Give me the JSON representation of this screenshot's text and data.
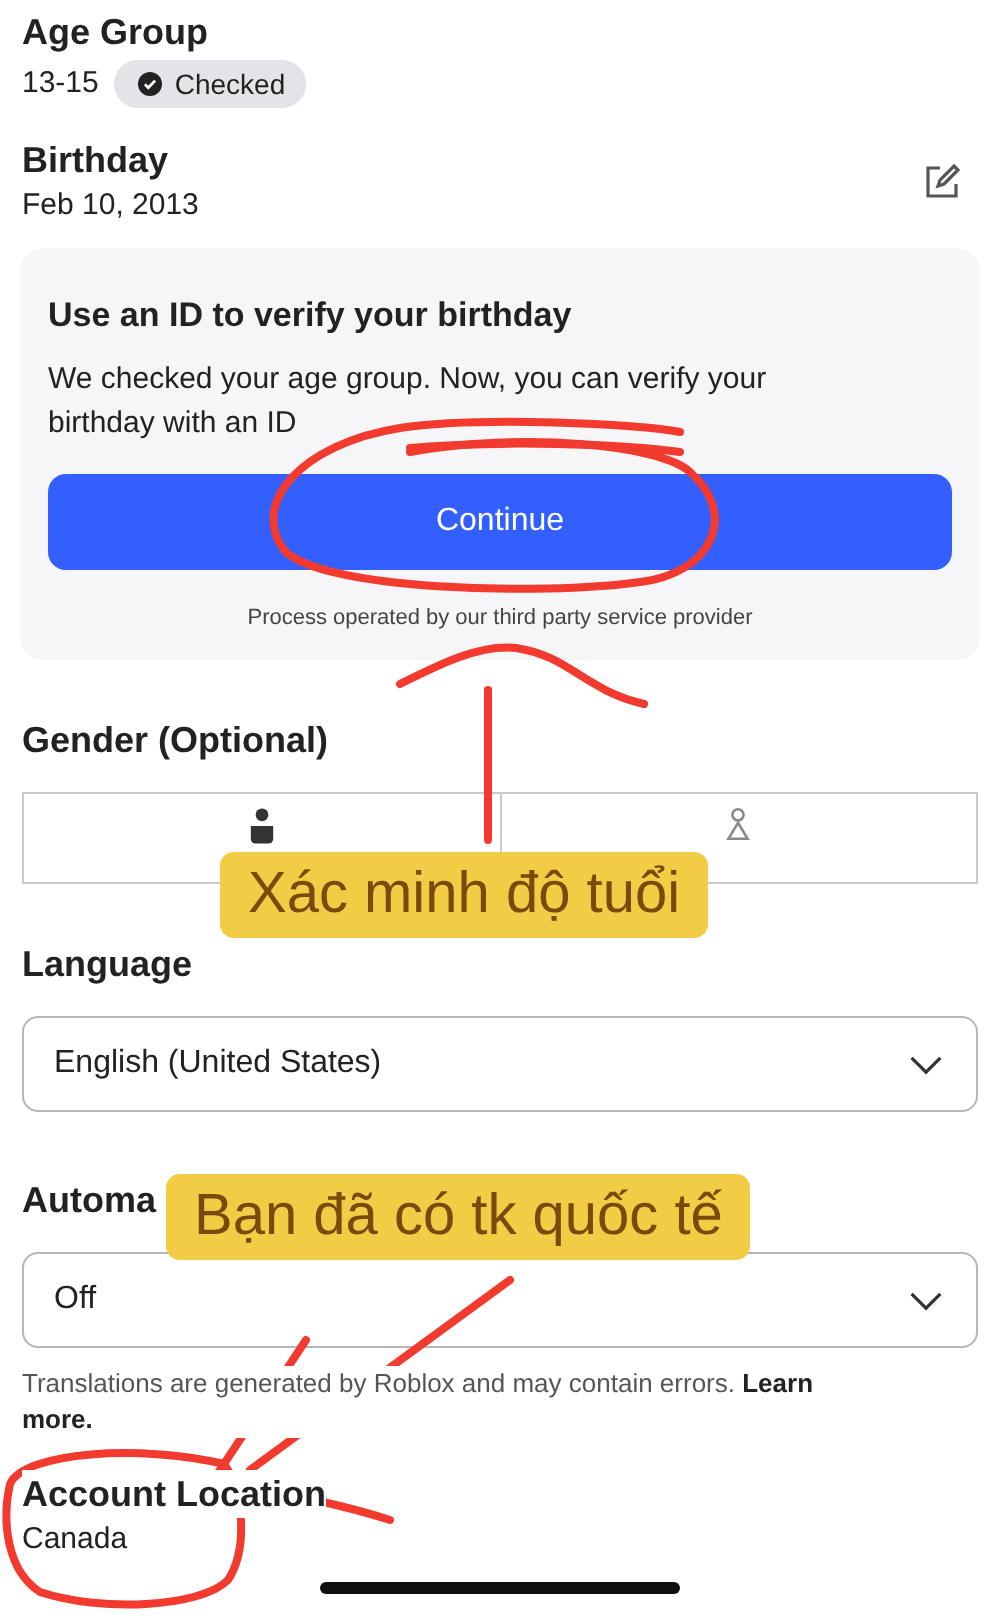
{
  "age_group": {
    "label": "Age Group",
    "value": "13-15",
    "badge": "Checked"
  },
  "birthday": {
    "label": "Birthday",
    "value": "Feb 10, 2013"
  },
  "verify_card": {
    "title": "Use an ID to verify your birthday",
    "body": "We checked your age group. Now, you can verify your birthday with an ID",
    "button": "Continue",
    "footnote": "Process operated by our third party service provider"
  },
  "gender": {
    "label": "Gender (Optional)",
    "options": [
      {
        "kind": "filled",
        "selected": true
      },
      {
        "kind": "outline",
        "selected": false
      }
    ]
  },
  "language": {
    "label": "Language",
    "value": "English (United States)"
  },
  "translation": {
    "label": "Automa",
    "value": "Off",
    "note": "Translations are generated by Roblox and may contain errors. **Learn more.**"
  },
  "account_location": {
    "label": "Account Location",
    "value": "Canada"
  },
  "annotations": [
    {
      "text": "Xác minh độ tuổi"
    },
    {
      "text": "Bạn đã có tk quốc tế"
    }
  ]
}
